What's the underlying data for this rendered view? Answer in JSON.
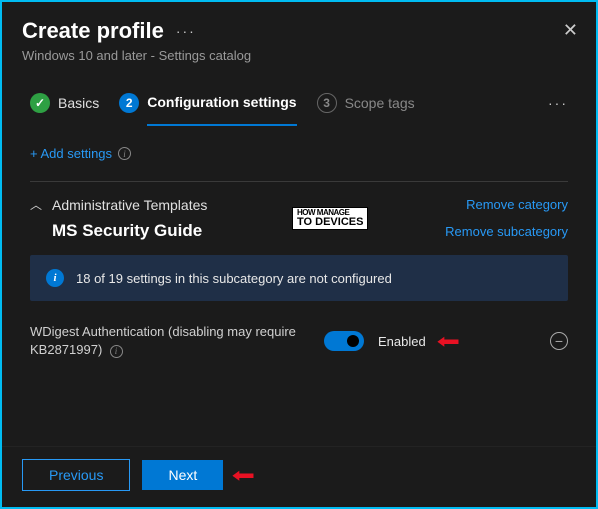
{
  "header": {
    "title": "Create profile",
    "subtitle": "Windows 10 and later - Settings catalog"
  },
  "stepper": {
    "step1": {
      "label": "Basics",
      "icon": "✓"
    },
    "step2": {
      "num": "2",
      "label": "Configuration settings"
    },
    "step3": {
      "num": "3",
      "label": "Scope tags"
    }
  },
  "actions": {
    "add_settings": "+ Add settings"
  },
  "category": {
    "name": "Administrative Templates",
    "remove": "Remove category"
  },
  "subcategory": {
    "name": "MS Security Guide",
    "remove": "Remove subcategory"
  },
  "status": {
    "text": "18 of 19 settings in this subcategory are not configured"
  },
  "setting": {
    "label": "WDigest Authentication (disabling may require KB2871997)",
    "toggle_state": "Enabled"
  },
  "footer": {
    "previous": "Previous",
    "next": "Next"
  }
}
